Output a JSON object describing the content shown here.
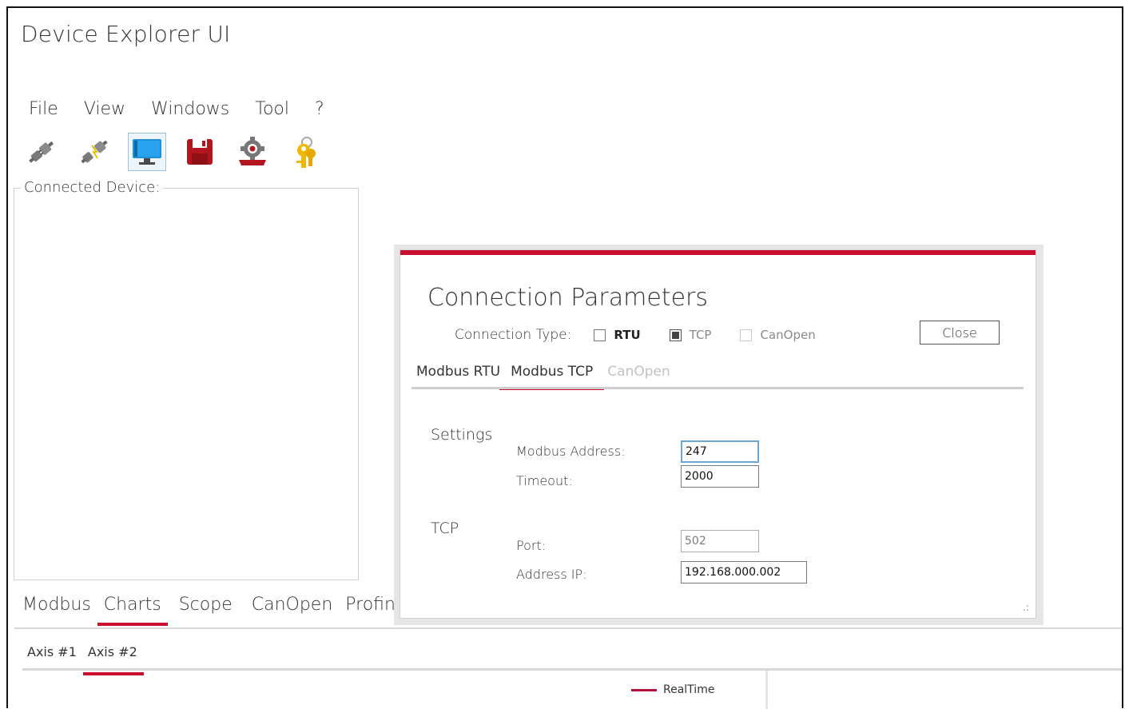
{
  "app": {
    "title": "Device Explorer UI"
  },
  "menu": {
    "items": [
      "File",
      "View",
      "Windows",
      "Tool",
      "?"
    ]
  },
  "toolbar": {
    "buttons": [
      {
        "icon": "plug-connect-icon"
      },
      {
        "icon": "plug-disconnect-icon"
      },
      {
        "icon": "monitor-icon"
      },
      {
        "icon": "save-icon"
      },
      {
        "icon": "settings-gear-icon"
      },
      {
        "icon": "keys-icon"
      }
    ]
  },
  "connected_device": {
    "legend": "Connected Device:"
  },
  "bottom_tabs": {
    "items": [
      "Modbus",
      "Charts",
      "Scope",
      "CanOpen",
      "Profinet"
    ],
    "selected": "Charts"
  },
  "axis_tabs": {
    "items": [
      "Axis #1",
      "Axis #2"
    ],
    "selected": "Axis #2"
  },
  "chart_legend": {
    "series": "RealTime",
    "color": "#b5123a"
  },
  "dialog": {
    "title": "Connection Parameters",
    "connection_type_label": "Connection Type:",
    "options": [
      {
        "label": "RTU",
        "checked": false,
        "enabled": true
      },
      {
        "label": "TCP",
        "checked": true,
        "enabled": false
      },
      {
        "label": "CanOpen",
        "checked": false,
        "enabled": false
      }
    ],
    "close_label": "Close",
    "tabs": [
      "Modbus RTU",
      "Modbus TCP",
      "CanOpen"
    ],
    "selected_tab": "Modbus TCP",
    "settings": {
      "heading": "Settings",
      "modbus_address_label": "Modbus Address:",
      "modbus_address_value": "247",
      "timeout_label": "Timeout:",
      "timeout_value": "2000"
    },
    "tcp": {
      "heading": "TCP",
      "port_label": "Port:",
      "port_value": "502",
      "address_ip_label": "Address IP:",
      "address_ip_value": "192.168.000.002"
    },
    "accent_color": "#c8102e"
  }
}
